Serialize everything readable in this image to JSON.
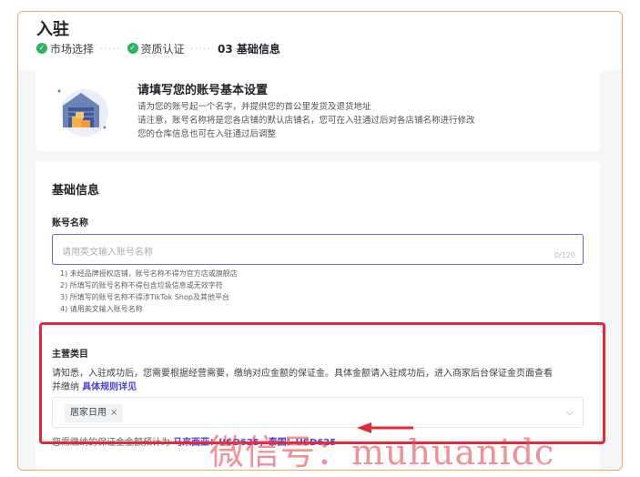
{
  "header": {
    "title": "入驻",
    "steps": [
      {
        "label": "市场选择"
      },
      {
        "label": "资质认证"
      },
      {
        "label": "03 基础信息"
      }
    ],
    "step_dots": "·····"
  },
  "intro": {
    "title": "请填写您的账号基本设置",
    "lines": [
      "请为您的账号起一个名字，并提供您的首公里发货及退货地址",
      "请注意，账号名称将是您各店铺的默认店铺名，您可在入驻通过后对各店铺名称进行修改",
      "您的仓库信息也可在入驻通过后调整"
    ]
  },
  "basic": {
    "section_title": "基础信息",
    "account_label": "账号名称",
    "account_input": {
      "value": "",
      "placeholder": "请用英文输入账号名称",
      "counter": "0/120"
    },
    "tips": [
      "1) 未经品牌授权店铺，账号名称不得为官方店或旗舰店",
      "2) 所填写的账号名称不得包含垃圾信息或无效字符",
      "3) 所填写的账号名称不得涉TikTok Shop及其他平台",
      "4) 请用英文输入账号名称"
    ]
  },
  "category": {
    "label": "主营类目",
    "desc_line1": "请知悉，入驻成功后，您需要根据经营需要，缴纳对应金额的保证金。具体金额请入驻成功后，进入商家后台保证金页面查看",
    "desc_line2": "并缴纳",
    "rules_link": "具体规则详见",
    "selected_tag": "居家日用",
    "tag_close": "×",
    "chevron": "⌵",
    "deposit_prefix": "您需缴纳的保证金金额预计为",
    "deposit_values": "马来西亚：USD625，泰国：USD625"
  },
  "overlay": {
    "watermark": "微信号：muhuanidc",
    "highlight_color": "#e0293a"
  },
  "colors": {
    "accent": "#4a3fcf",
    "success": "#2bb55e",
    "input_focus": "#7c5cd6"
  }
}
